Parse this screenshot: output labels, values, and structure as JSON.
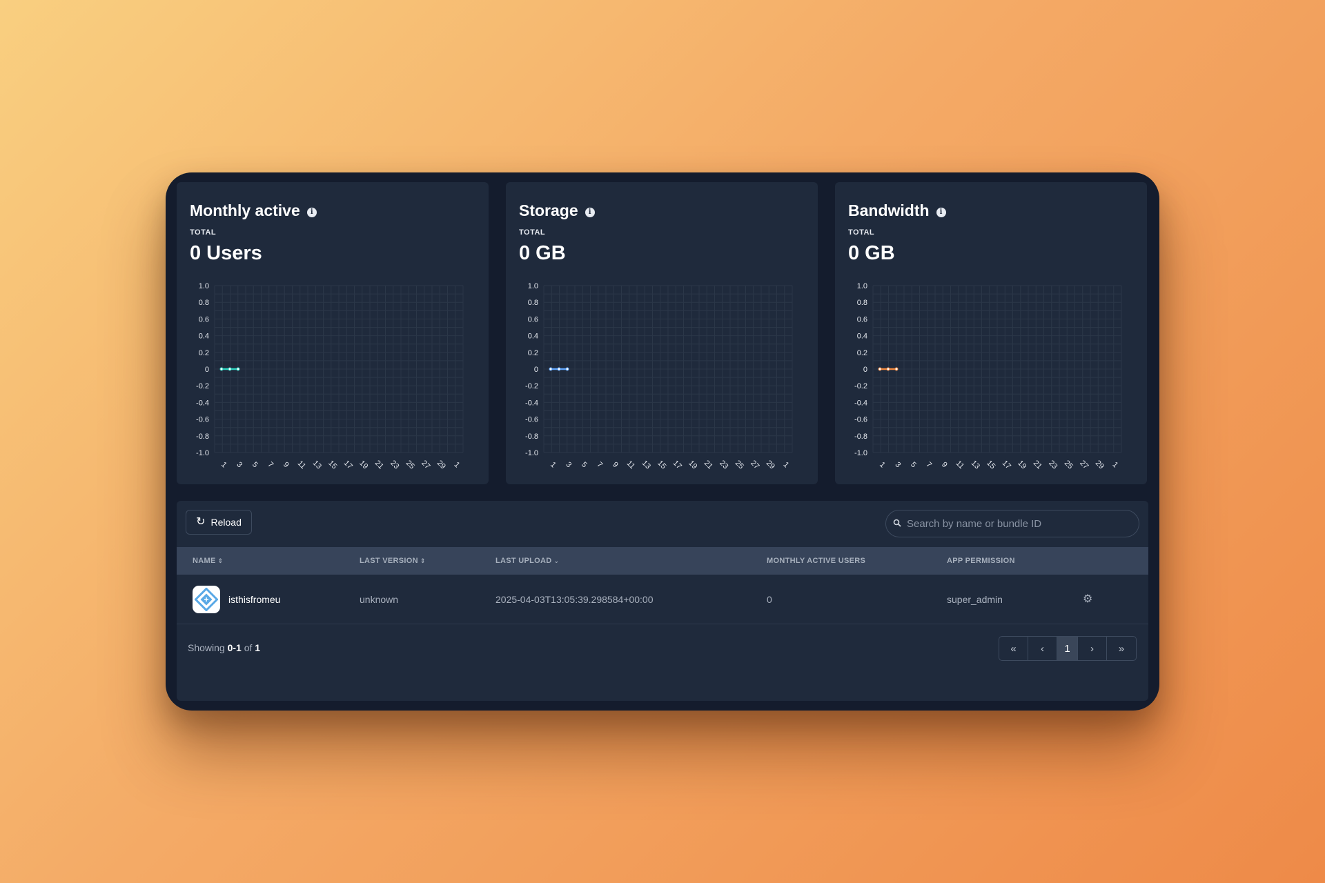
{
  "colors": {
    "users_series": "#2dd4bf",
    "storage_series": "#60a5fa",
    "bandwidth_series": "#f0883e"
  },
  "cards": [
    {
      "title": "Monthly active",
      "subtitle": "TOTAL",
      "total": "0 Users",
      "icon": "info-icon",
      "chart_data": {
        "type": "line",
        "x": [
          "1",
          "3",
          "5",
          "7",
          "9",
          "11",
          "13",
          "15",
          "17",
          "19",
          "21",
          "23",
          "25",
          "27",
          "29",
          "1"
        ],
        "y_ticks": [
          "1.0",
          "0.8",
          "0.6",
          "0.4",
          "0.2",
          "0",
          "-0.2",
          "-0.4",
          "-0.6",
          "-0.8",
          "-1.0"
        ],
        "ylim": [
          -1,
          1
        ],
        "series": [
          {
            "values": [
              0,
              0,
              0
            ]
          }
        ],
        "grid": true
      }
    },
    {
      "title": "Storage",
      "subtitle": "TOTAL",
      "total": "0 GB",
      "icon": "info-icon",
      "chart_data": {
        "type": "line",
        "x": [
          "1",
          "3",
          "5",
          "7",
          "9",
          "11",
          "13",
          "15",
          "17",
          "19",
          "21",
          "23",
          "25",
          "27",
          "29",
          "1"
        ],
        "y_ticks": [
          "1.0",
          "0.8",
          "0.6",
          "0.4",
          "0.2",
          "0",
          "-0.2",
          "-0.4",
          "-0.6",
          "-0.8",
          "-1.0"
        ],
        "ylim": [
          -1,
          1
        ],
        "series": [
          {
            "values": [
              0,
              0,
              0
            ]
          }
        ],
        "grid": true
      }
    },
    {
      "title": "Bandwidth",
      "subtitle": "TOTAL",
      "total": "0 GB",
      "icon": "info-icon",
      "chart_data": {
        "type": "line",
        "x": [
          "1",
          "3",
          "5",
          "7",
          "9",
          "11",
          "13",
          "15",
          "17",
          "19",
          "21",
          "23",
          "25",
          "27",
          "29",
          "1"
        ],
        "y_ticks": [
          "1.0",
          "0.8",
          "0.6",
          "0.4",
          "0.2",
          "0",
          "-0.2",
          "-0.4",
          "-0.6",
          "-0.8",
          "-1.0"
        ],
        "ylim": [
          -1,
          1
        ],
        "series": [
          {
            "values": [
              0,
              0,
              0
            ]
          }
        ],
        "grid": true
      }
    }
  ],
  "toolbar": {
    "reload_label": "Reload",
    "reload_icon": "reload-icon",
    "search_placeholder": "Search by name or bundle ID",
    "search_icon": "search-icon"
  },
  "table": {
    "headers": {
      "name": "NAME",
      "last_version": "LAST VERSION",
      "last_upload": "LAST UPLOAD",
      "monthly_active_users": "MONTHLY ACTIVE USERS",
      "app_permission": "APP PERMISSION"
    },
    "rows": [
      {
        "name": "isthisfromeu",
        "last_version": "unknown",
        "last_upload": "2025-04-03T13:05:39.298584+00:00",
        "monthly_active_users": "0",
        "app_permission": "super_admin",
        "action_icon": "gear-icon"
      }
    ]
  },
  "footer": {
    "showing_prefix": "Showing",
    "range": "0-1",
    "of_word": "of",
    "total": "1"
  },
  "pagination": {
    "first": "«",
    "prev": "‹",
    "current_page": "1",
    "next": "›",
    "last": "»"
  }
}
